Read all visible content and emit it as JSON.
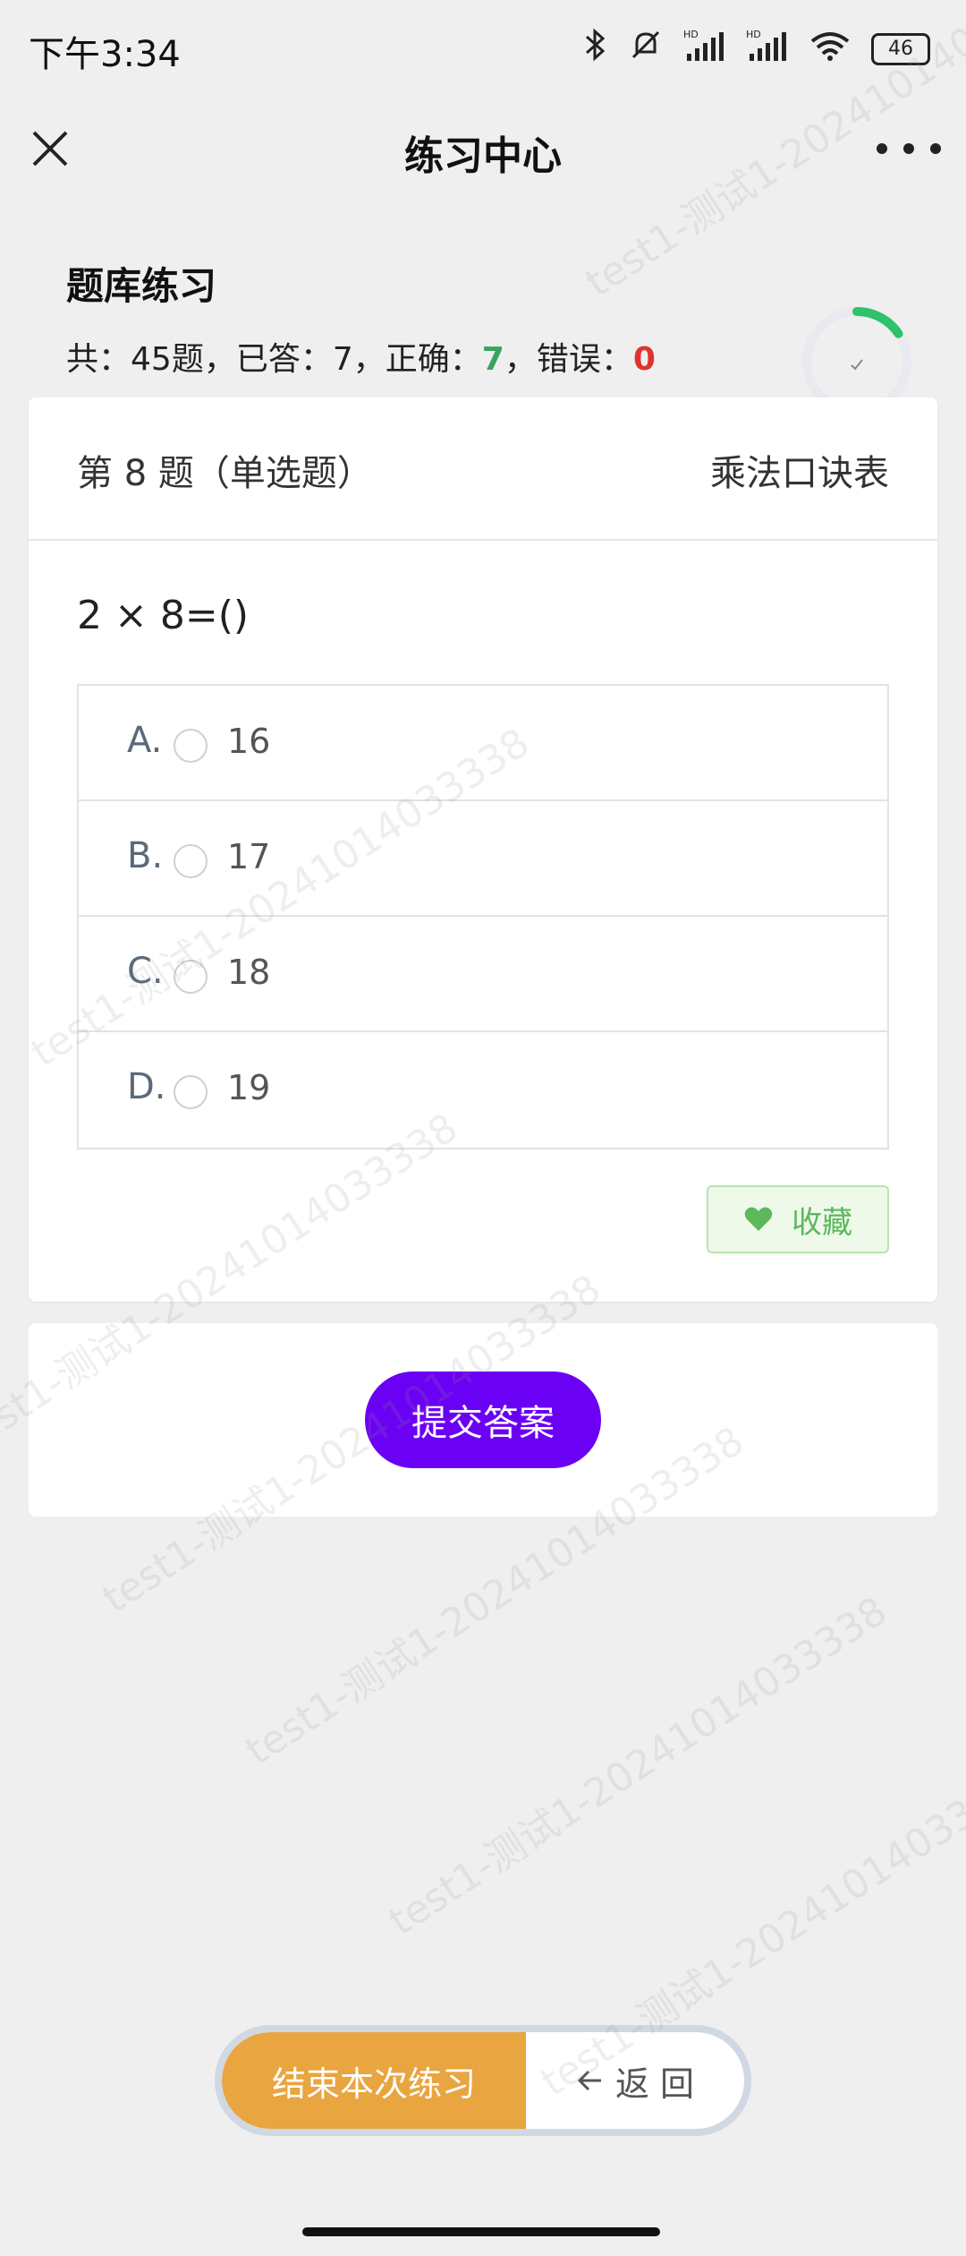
{
  "status_bar": {
    "time": "下午3:34",
    "battery": "46",
    "icons": [
      "bluetooth-icon",
      "mute-icon",
      "signal-hd-icon",
      "signal-hd-icon",
      "wifi-icon"
    ]
  },
  "nav": {
    "title": "练习中心",
    "close_icon": "close-icon",
    "more_icon": "more-icon"
  },
  "summary": {
    "title": "题库练习",
    "total_label": "共：",
    "total": "45题",
    "answered_label": "，已答：",
    "answered": "7",
    "correct_label": "，正确：",
    "correct": "7",
    "wrong_label": "，错误：",
    "wrong": "0",
    "progress_fraction": 0.15556
  },
  "question": {
    "number_label": "第 8 题（单选题）",
    "category": "乘法口诀表",
    "stem": "2 × 8=()",
    "options": [
      {
        "letter": "A.",
        "value": "16"
      },
      {
        "letter": "B.",
        "value": "17"
      },
      {
        "letter": "C.",
        "value": "18"
      },
      {
        "letter": "D.",
        "value": "19"
      }
    ],
    "favorite_label": "收藏"
  },
  "actions": {
    "submit_label": "提交答案",
    "end_label": "结束本次练习",
    "back_label": "返 回"
  },
  "watermark": "test1-测试1-20241014033338",
  "colors": {
    "correct": "#3aa35b",
    "wrong": "#e0332f",
    "submit": "#6a00f4",
    "end": "#e8a540",
    "favorite": "#5cb85c"
  }
}
